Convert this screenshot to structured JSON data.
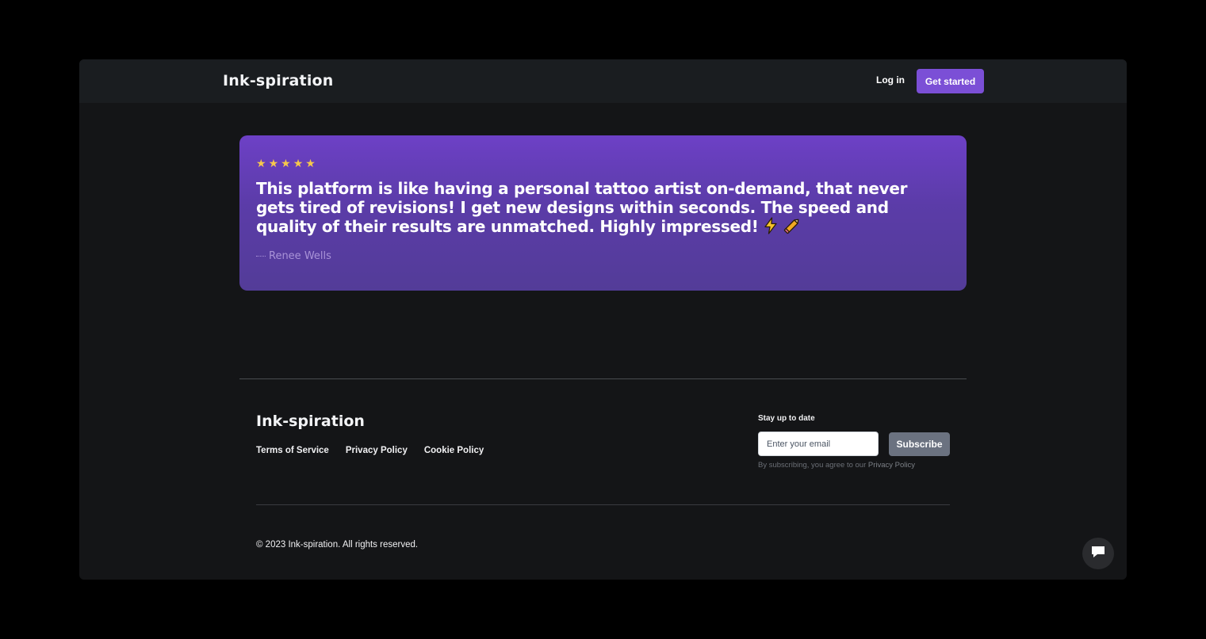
{
  "header": {
    "brand": "Ink-spiration",
    "login_label": "Log in",
    "cta_label": "Get started",
    "accent_color": "#7b4fd6"
  },
  "testimonial": {
    "rating": 5,
    "stars": [
      "★",
      "★",
      "★",
      "★",
      "★"
    ],
    "quote": "This platform is like having a personal tattoo artist on-demand, that never gets tired of revisions! I get new designs within seconds. The speed and quality of their results are unmatched. Highly impressed!",
    "emoji": [
      "⚡",
      "🖊"
    ],
    "author": "Renee Wells"
  },
  "footer": {
    "brand": "Ink-spiration",
    "links": [
      "Terms of Service",
      "Privacy Policy",
      "Cookie Policy"
    ],
    "newsletter": {
      "heading": "Stay up to date",
      "email_placeholder": "Enter your email",
      "subscribe_label": "Subscribe",
      "disclaimer": "By subscribing, you agree to our ",
      "disclaimer_link": "Privacy Policy"
    },
    "copyright": "© 2023 Ink-spiration. All rights reserved."
  },
  "chat": {
    "icon": "chat-bubble-icon"
  }
}
